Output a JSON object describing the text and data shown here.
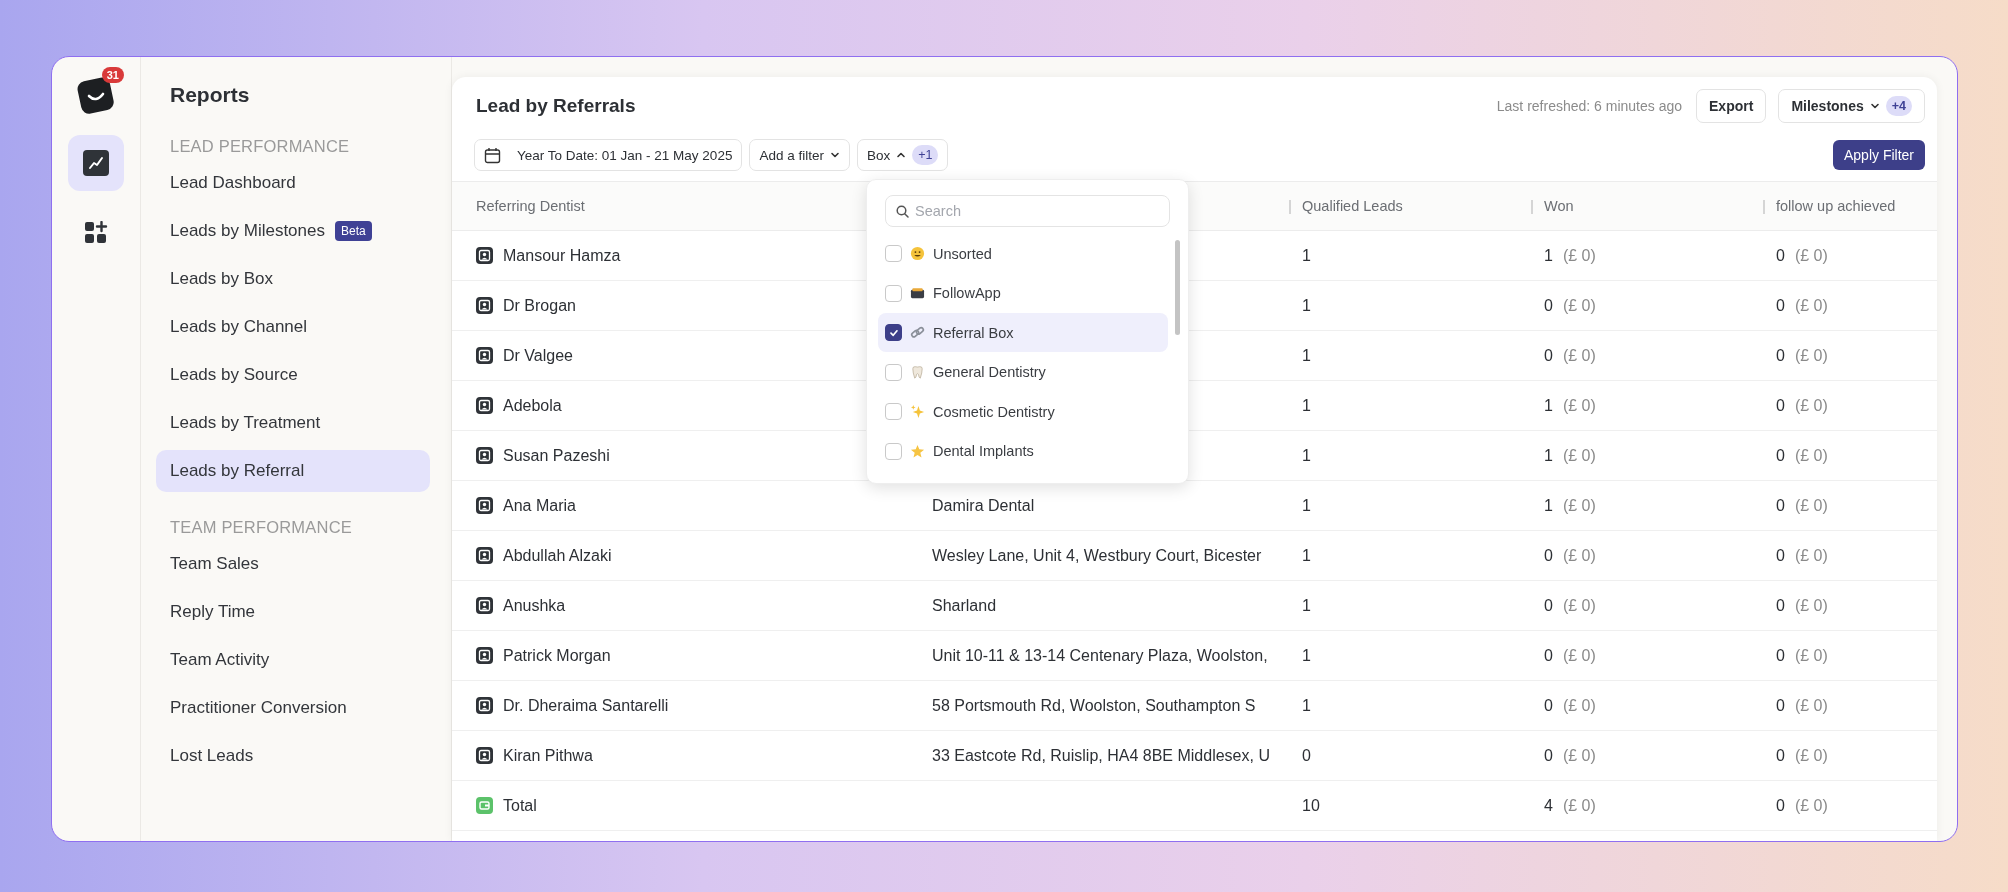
{
  "rail": {
    "badge": "31",
    "items": [
      {
        "kind": "chart",
        "selected": true
      },
      {
        "kind": "apps",
        "selected": false
      }
    ]
  },
  "sidebar": {
    "title": "Reports",
    "sections": [
      {
        "heading": "LEAD PERFORMANCE",
        "items": [
          {
            "label": "Lead Dashboard",
            "selected": false
          },
          {
            "label": "Leads by Milestones",
            "badge": "Beta",
            "selected": false
          },
          {
            "label": "Leads by Box",
            "selected": false
          },
          {
            "label": "Leads by Channel",
            "selected": false
          },
          {
            "label": "Leads by Source",
            "selected": false
          },
          {
            "label": "Leads by Treatment",
            "selected": false
          },
          {
            "label": "Leads by Referral",
            "selected": true
          }
        ]
      },
      {
        "heading": "TEAM PERFORMANCE",
        "items": [
          {
            "label": "Team Sales",
            "selected": false
          },
          {
            "label": "Reply Time",
            "selected": false
          },
          {
            "label": "Team Activity",
            "selected": false
          },
          {
            "label": "Practitioner Conversion",
            "selected": false
          },
          {
            "label": "Lost Leads",
            "selected": false
          }
        ]
      }
    ]
  },
  "report": {
    "title": "Lead by Referrals",
    "last_refreshed": "Last refreshed: 6 minutes ago",
    "export": "Export",
    "milestones": {
      "label": "Milestones",
      "count": "+4"
    }
  },
  "filters": {
    "date": "Year To Date: 01 Jan - 21 May 2025",
    "add": "Add a filter",
    "box": {
      "label": "Box",
      "count": "+1",
      "expanded": true
    },
    "apply": "Apply Filter"
  },
  "dropdown": {
    "placeholder": "Search",
    "items": [
      {
        "label": "Unsorted",
        "checked": false
      },
      {
        "label": "FollowApp",
        "checked": false
      },
      {
        "label": "Referral Box",
        "checked": true
      },
      {
        "label": "General Dentistry",
        "checked": false
      },
      {
        "label": "Cosmetic Dentistry",
        "checked": false
      },
      {
        "label": "Dental Implants",
        "checked": false
      }
    ]
  },
  "table": {
    "columns": [
      "Referring Dentist",
      "Qualified Leads",
      "Won",
      "follow up achieved"
    ],
    "rows": [
      {
        "kind": "person",
        "name": "Mansour Hamza",
        "qualified": "1",
        "won": "1",
        "won_amount": "(£ 0)",
        "followup": "0",
        "followup_amount": "(£ 0)"
      },
      {
        "kind": "person",
        "name": "Dr Brogan",
        "qualified": "1",
        "won": "0",
        "won_amount": "(£ 0)",
        "followup": "0",
        "followup_amount": "(£ 0)"
      },
      {
        "kind": "person",
        "name": "Dr Valgee",
        "qualified": "1",
        "won": "0",
        "won_amount": "(£ 0)",
        "followup": "0",
        "followup_amount": "(£ 0)"
      },
      {
        "kind": "person",
        "name": "Adebola",
        "qualified": "1",
        "won": "1",
        "won_amount": "(£ 0)",
        "followup": "0",
        "followup_amount": "(£ 0)"
      },
      {
        "kind": "person",
        "name": "Susan Pazeshi",
        "qualified": "1",
        "won": "1",
        "won_amount": "(£ 0)",
        "followup": "0",
        "followup_amount": "(£ 0)"
      },
      {
        "kind": "person",
        "name": "Ana Maria",
        "column_2": "Damira Dental",
        "qualified": "1",
        "won": "1",
        "won_amount": "(£ 0)",
        "followup": "0",
        "followup_amount": "(£ 0)"
      },
      {
        "kind": "person",
        "name": "Abdullah Alzaki",
        "column_2": "Wesley Lane, Unit 4, Westbury Court, Bicester",
        "qualified": "1",
        "won": "0",
        "won_amount": "(£ 0)",
        "followup": "0",
        "followup_amount": "(£ 0)"
      },
      {
        "kind": "person",
        "name": "Anushka",
        "column_2": "Sharland",
        "qualified": "1",
        "won": "0",
        "won_amount": "(£ 0)",
        "followup": "0",
        "followup_amount": "(£ 0)"
      },
      {
        "kind": "person",
        "name": "Patrick Morgan",
        "column_2": "Unit 10-11 & 13-14 Centenary Plaza, Woolston,",
        "qualified": "1",
        "won": "0",
        "won_amount": "(£ 0)",
        "followup": "0",
        "followup_amount": "(£ 0)"
      },
      {
        "kind": "person",
        "name": "Dr. Dheraima Santarelli",
        "column_2": "58 Portsmouth Rd, Woolston, Southampton S",
        "qualified": "1",
        "won": "0",
        "won_amount": "(£ 0)",
        "followup": "0",
        "followup_amount": "(£ 0)"
      },
      {
        "kind": "person",
        "name": "Kiran Pithwa",
        "column_2": "33 Eastcote Rd, Ruislip, HA4 8BE Middlesex, U",
        "qualified": "0",
        "won": "0",
        "won_amount": "(£ 0)",
        "followup": "0",
        "followup_amount": "(£ 0)"
      },
      {
        "kind": "total",
        "name": "Total",
        "qualified": "10",
        "won": "4",
        "won_amount": "(£ 0)",
        "followup": "0",
        "followup_amount": "(£ 0)"
      }
    ]
  }
}
